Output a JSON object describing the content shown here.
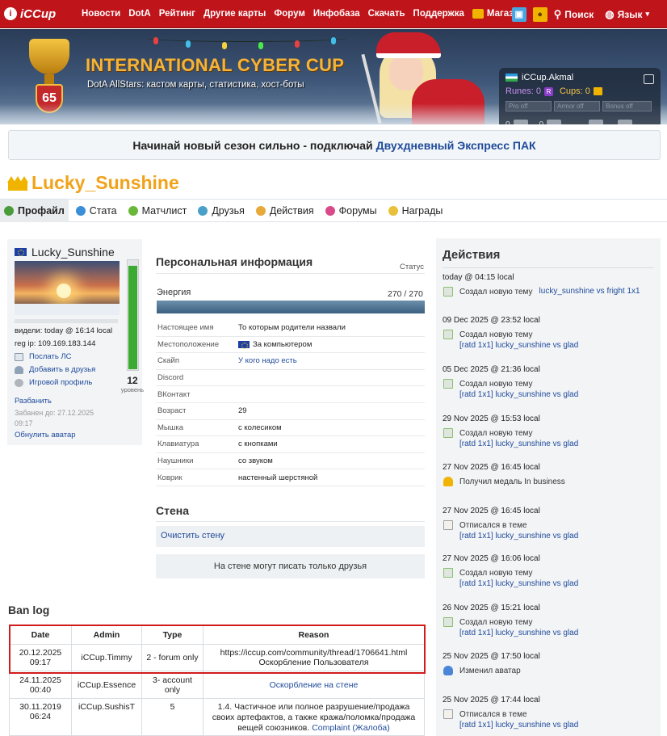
{
  "nav": {
    "logo": "iCCup",
    "items": [
      "Новости",
      "DotA",
      "Рейтинг",
      "Другие карты",
      "Форум",
      "Инфобаза",
      "Скачать",
      "Поддержка",
      "Магазин"
    ],
    "search": "Поиск",
    "language": "Язык"
  },
  "banner": {
    "title": "INTERNATIONAL CYBER CUP",
    "subtitle": "DotA AllStars: кастом карты, статистика, хост-боты",
    "level": "65"
  },
  "account": {
    "username": "iCCup.Akmal",
    "runes_label": "Runes:",
    "runes": "0",
    "runes_icon": "R",
    "cups_label": "Cups:",
    "cups": "0",
    "pro_off": "Pro off",
    "armor_off": "Armor off",
    "bonus_off": "Bonus off",
    "messages": "0",
    "alerts": "0"
  },
  "promo": {
    "text": "Начинай новый сезон сильно - подключай",
    "link": "Двухдневный Экспресс ПАК"
  },
  "profile": {
    "name": "Lucky_Sunshine",
    "tabs": [
      "Профайл",
      "Стата",
      "Матчлист",
      "Друзья",
      "Действия",
      "Форумы",
      "Награды"
    ],
    "card": {
      "name": "Lucky_Sunshine",
      "seen": "видели: today @ 16:14 local",
      "reg_ip": "reg ip: 109.169.183.144",
      "send_pm": "Послать ЛС",
      "add_friend": "Добавить в друзья",
      "game_profile": "Игровой профиль",
      "level": "12",
      "level_label": "уровень",
      "energy_fill_pct": 100,
      "unban": "Разбанить",
      "banned_until": "Забанен до: 27.12.2025 09:17",
      "reset_avatar": "Обнулить аватар"
    }
  },
  "personal": {
    "title": "Персональная информация",
    "status": "Статус",
    "energy_label": "Энергия",
    "energy_value": "270 / 270",
    "fields": [
      {
        "k": "Настоящее имя",
        "v": "То которым родители назвали"
      },
      {
        "k": "Местоположение",
        "v": "За компьютером"
      },
      {
        "k": "Скайп",
        "v": "У кого надо есть"
      },
      {
        "k": "Discord",
        "v": ""
      },
      {
        "k": "ВКонтакт",
        "v": ""
      },
      {
        "k": "Возраст",
        "v": "29"
      },
      {
        "k": "Мышка",
        "v": "с колесиком"
      },
      {
        "k": "Клавиатура",
        "v": "с кнопками"
      },
      {
        "k": "Наушники",
        "v": "со звуком"
      },
      {
        "k": "Коврик",
        "v": "настенный шерстяной"
      }
    ]
  },
  "wall": {
    "title": "Стена",
    "clear": "Очистить стену",
    "note": "На стене могут писать только друзья"
  },
  "banlog": {
    "title": "Ban log",
    "headers": [
      "Date",
      "Admin",
      "Type",
      "Reason"
    ],
    "rows": [
      {
        "date": "20.12.2025 09:17",
        "admin": "iCCup.Timmy",
        "type": "2 - forum only",
        "reason": "https://iccup.com/community/thread/1706641.html Оскорбление Пользователя"
      },
      {
        "date": "24.11.2025 00:40",
        "admin": "iCCup.Essence",
        "type": "3- account only",
        "reason": "Оскорбление на стене"
      },
      {
        "date": "30.11.2019 06:24",
        "admin": "iCCup.SushisT",
        "type": "5",
        "reason": "1.4. Частичное или полное разрушение/продажа своих артефактов, а также кража/поломка/продажа вещей союзников.",
        "reason_link": "Complaint (Жалоба)"
      }
    ]
  },
  "actions": {
    "title": "Действия",
    "items": [
      {
        "date": "today @ 04:15 local",
        "icon": "new-topic",
        "text": "Создал новую тему",
        "link": "lucky_sunshine vs fright 1x1"
      },
      {
        "date": "09 Dec 2025 @ 23:52 local",
        "icon": "new-topic",
        "text": "Создал новую тему",
        "link": "[ratd 1x1] lucky_sunshine vs glad"
      },
      {
        "date": "05 Dec 2025 @ 21:36 local",
        "icon": "new-topic",
        "text": "Создал новую тему",
        "link": "[ratd 1x1] lucky_sunshine vs glad"
      },
      {
        "date": "29 Nov 2025 @ 15:53 local",
        "icon": "new-topic",
        "text": "Создал новую тему",
        "link": "[ratd 1x1] lucky_sunshine vs glad"
      },
      {
        "date": "27 Nov 2025 @ 16:45 local",
        "icon": "medal",
        "text": "Получил медаль  In business",
        "link": ""
      },
      {
        "date": "27 Nov 2025 @ 16:45 local",
        "icon": "post",
        "text": "Отписался в теме",
        "link": "[ratd 1x1] lucky_sunshine vs glad"
      },
      {
        "date": "27 Nov 2025 @ 16:06 local",
        "icon": "new-topic",
        "text": "Создал новую тему",
        "link": "[ratd 1x1] lucky_sunshine vs glad"
      },
      {
        "date": "26 Nov 2025 @ 15:21 local",
        "icon": "new-topic",
        "text": "Создал новую тему",
        "link": "[ratd 1x1] lucky_sunshine vs glad"
      },
      {
        "date": "25 Nov 2025 @ 17:50 local",
        "icon": "avatar",
        "text": "Изменил аватар",
        "link": ""
      },
      {
        "date": "25 Nov 2025 @ 17:44 local",
        "icon": "post",
        "text": "Отписался в теме",
        "link": "[ratd 1x1] lucky_sunshine vs glad"
      }
    ]
  }
}
